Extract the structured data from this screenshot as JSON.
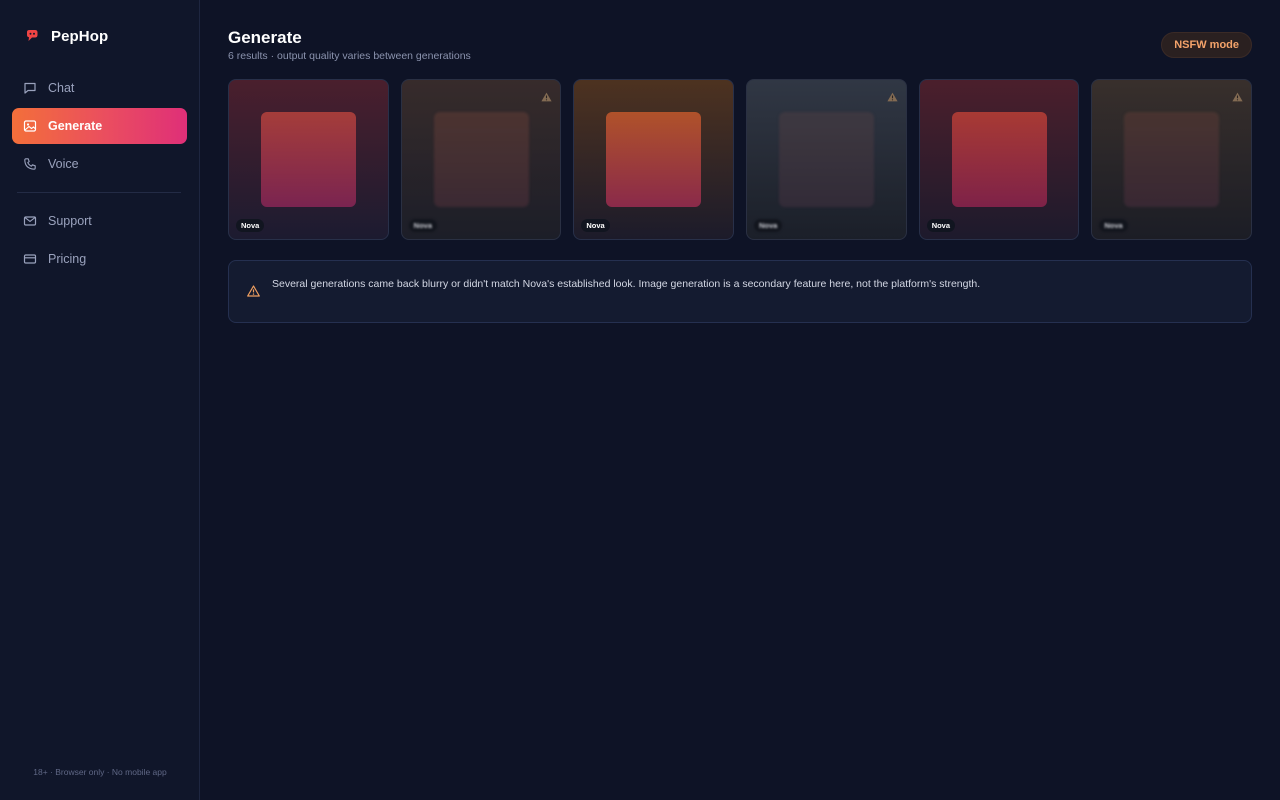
{
  "brand": {
    "name": "PepHop",
    "accent": "#ef4444"
  },
  "nav": {
    "primary": [
      {
        "label": "Chat",
        "icon": "chat-bubble-icon",
        "active": false
      },
      {
        "label": "Generate",
        "icon": "image-icon",
        "active": true
      },
      {
        "label": "Voice",
        "icon": "phone-icon",
        "active": false
      }
    ],
    "secondary": [
      {
        "label": "Support",
        "icon": "mail-icon"
      },
      {
        "label": "Pricing",
        "icon": "credit-card-icon"
      }
    ]
  },
  "sidebar_footer": "18+ · Browser only · No mobile app",
  "page": {
    "title": "Generate",
    "subtitle": "6 results · output quality varies between generations",
    "nsfw_label": "NSFW mode"
  },
  "results": [
    {
      "tag": "Nova",
      "warning": false,
      "bg_top": "#4a1f2d",
      "bg_bottom": "#1c1b30",
      "inner_top": "#a53d3a",
      "inner_bottom": "#7a2450"
    },
    {
      "tag": "Nova",
      "warning": true,
      "bg_top": "#3a2a2a",
      "bg_bottom": "#1b1e2b",
      "inner_top": "#5d3630",
      "inner_bottom": "#4b2a38"
    },
    {
      "tag": "Nova",
      "warning": false,
      "bg_top": "#4d3220",
      "bg_bottom": "#1c1b2a",
      "inner_top": "#b0522a",
      "inner_bottom": "#8a2a4a"
    },
    {
      "tag": "Nova",
      "warning": true,
      "bg_top": "#2e3748",
      "bg_bottom": "#1a1f2c",
      "inner_top": "#463a44",
      "inner_bottom": "#3c2c3e"
    },
    {
      "tag": "Nova",
      "warning": false,
      "bg_top": "#4b1f2c",
      "bg_bottom": "#1d1a2c",
      "inner_top": "#a83a34",
      "inner_bottom": "#7e2248"
    },
    {
      "tag": "Nova",
      "warning": true,
      "bg_top": "#3a2f2a",
      "bg_bottom": "#1b1d28",
      "inner_top": "#573630",
      "inner_bottom": "#45293a"
    }
  ],
  "notice": {
    "icon": "warning-triangle-icon",
    "text": "Several generations came back blurry or didn't match Nova's established look. Image generation is a secondary feature here, not the platform's strength."
  },
  "colors": {
    "warning": "#f0a060",
    "background": "#0e1326"
  }
}
